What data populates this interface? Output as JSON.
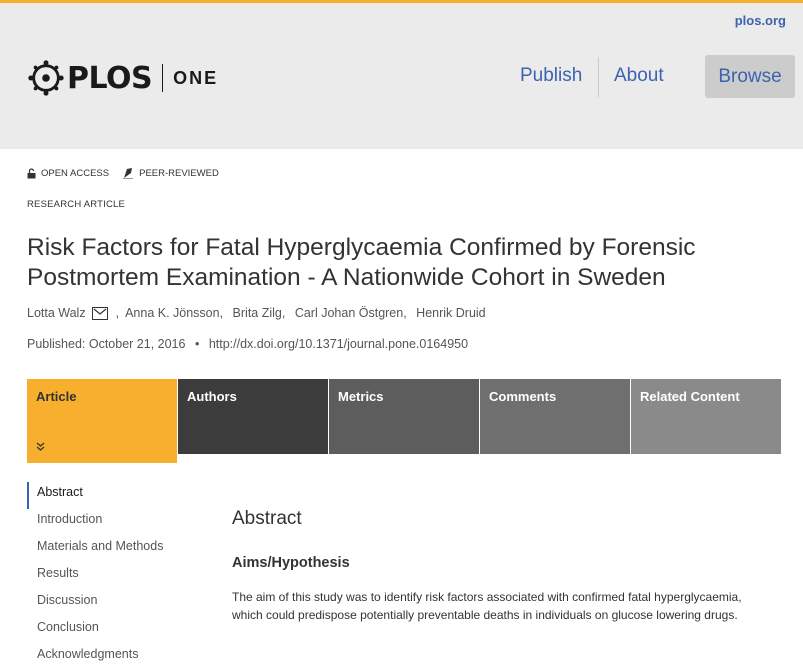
{
  "header": {
    "site_link": "plos.org",
    "logo_main": "PLOS",
    "logo_journal": "ONE",
    "nav": {
      "publish": "Publish",
      "about": "About",
      "browse": "Browse"
    }
  },
  "article": {
    "badges": {
      "open_access": "OPEN ACCESS",
      "peer_reviewed": "PEER-REVIEWED"
    },
    "type": "RESEARCH ARTICLE",
    "title": "Risk Factors for Fatal Hyperglycaemia Confirmed by Forensic Postmortem Examination - A Nationwide Cohort in Sweden",
    "authors": [
      "Lotta Walz",
      "Anna K. Jönsson",
      "Brita Zilg",
      "Carl Johan Östgren",
      "Henrik Druid"
    ],
    "published_label": "Published:",
    "published_date": "October 21, 2016",
    "doi": "http://dx.doi.org/10.1371/journal.pone.0164950"
  },
  "tabs": [
    "Article",
    "Authors",
    "Metrics",
    "Comments",
    "Related Content"
  ],
  "toc": [
    "Abstract",
    "Introduction",
    "Materials and Methods",
    "Results",
    "Discussion",
    "Conclusion",
    "Acknowledgments"
  ],
  "content": {
    "heading": "Abstract",
    "subheading": "Aims/Hypothesis",
    "paragraph": "The aim of this study was to identify risk factors associated with confirmed fatal hyperglycaemia, which could predispose potentially preventable deaths in individuals on glucose lowering drugs."
  },
  "colors": {
    "accent": "#f8af2d",
    "link": "#3c63af"
  },
  "icons": {
    "open_access": "unlock-icon",
    "peer_reviewed": "peer-review-icon",
    "email": "mail-icon",
    "expand": "chevron-down-double-icon"
  }
}
